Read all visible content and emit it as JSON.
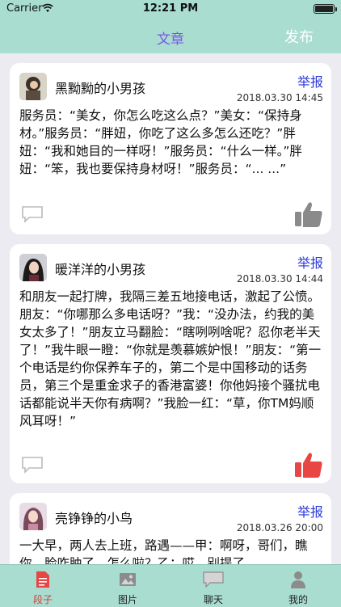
{
  "status_bar": {
    "carrier": "Carrier",
    "time": "12:21 PM"
  },
  "nav": {
    "title": "文章",
    "publish_label": "发布"
  },
  "colors": {
    "accent": "#7a55e6",
    "bar_bg": "#a8ddcf",
    "report": "#2b3ad6",
    "like_active": "#e84545",
    "like_inactive": "#8a8a8a"
  },
  "posts": [
    {
      "username": "黑黝黝的小男孩",
      "report_label": "举报",
      "date": "2018.03.30 14:45",
      "text": "服务员：“美女，你怎么吃这么点？”美女：“保持身材。”服务员：“胖妞，你吃了这么多怎么还吃？”胖妞：“我和她目的一样呀！”服务员：“什么一样。”胖妞：“笨，我也要保持身材呀！”服务员：“... ...”",
      "liked": false
    },
    {
      "username": "暖洋洋的小男孩",
      "report_label": "举报",
      "date": "2018.03.30 14:44",
      "text": "和朋友一起打牌，我隔三差五地接电话，激起了公愤。朋友：“你哪那么多电话呀？”我：“没办法，约我的美女太多了！”朋友立马翻脸：“瞎咧咧啥呢？忍你老半天了！”我牛眼一瞪：“你就是羡慕嫉妒恨！”朋友：“第一个电话是约你保养车子的，第二个是中国移动的话务员，第三个是重金求子的香港富婆！你他妈接个骚扰电话都能说半天你有病啊？”我脸一红：“草，你TM妈顺风耳呀！”",
      "liked": true
    },
    {
      "username": "亮铮铮的小鸟",
      "report_label": "举报",
      "date": "2018.03.26 20:00",
      "text": "一大早，两人去上班，路遇——甲：啊呀，哥们，瞧你，脸咋肿了，怎么啦？乙：哎，别提了",
      "liked": false
    }
  ],
  "tabs": [
    {
      "label": "段子",
      "icon": "document-icon",
      "active": true
    },
    {
      "label": "图片",
      "icon": "image-icon",
      "active": false
    },
    {
      "label": "聊天",
      "icon": "chat-icon",
      "active": false
    },
    {
      "label": "我的",
      "icon": "person-icon",
      "active": false
    }
  ]
}
